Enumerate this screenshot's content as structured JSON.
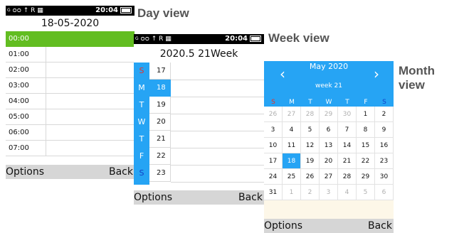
{
  "labels": {
    "day": "Day view",
    "week": "Week view",
    "month": "Month view"
  },
  "statusbar": {
    "signal": "G",
    "icons": "ᴑᴑ ↑ R ▦",
    "time": "20:04"
  },
  "softkeys": {
    "left": "Options",
    "right": "Back"
  },
  "day": {
    "title": "18-05-2020",
    "hours": [
      "00:00",
      "01:00",
      "02:00",
      "03:00",
      "04:00",
      "05:00",
      "06:00",
      "07:00"
    ],
    "selected_index": 0
  },
  "week": {
    "title": "2020.5 21Week",
    "days": [
      {
        "letter": "S",
        "date": "17",
        "color": "red"
      },
      {
        "letter": "M",
        "date": "18",
        "selected": true
      },
      {
        "letter": "T",
        "date": "19"
      },
      {
        "letter": "W",
        "date": "20"
      },
      {
        "letter": "T",
        "date": "21"
      },
      {
        "letter": "F",
        "date": "22"
      },
      {
        "letter": "S",
        "date": "23",
        "color": "blue"
      }
    ]
  },
  "month": {
    "title": "May 2020",
    "subtitle": "week 21",
    "prev_icon": "chevron-left",
    "next_icon": "chevron-right",
    "weekdays": [
      "S",
      "M",
      "T",
      "W",
      "T",
      "F",
      "S"
    ],
    "cells": [
      {
        "d": "26",
        "m": true
      },
      {
        "d": "27",
        "m": true
      },
      {
        "d": "28",
        "m": true
      },
      {
        "d": "29",
        "m": true
      },
      {
        "d": "30",
        "m": true
      },
      {
        "d": "1"
      },
      {
        "d": "2"
      },
      {
        "d": "3"
      },
      {
        "d": "4"
      },
      {
        "d": "5"
      },
      {
        "d": "6"
      },
      {
        "d": "7"
      },
      {
        "d": "8"
      },
      {
        "d": "9"
      },
      {
        "d": "10"
      },
      {
        "d": "11"
      },
      {
        "d": "12"
      },
      {
        "d": "13"
      },
      {
        "d": "14"
      },
      {
        "d": "15"
      },
      {
        "d": "16"
      },
      {
        "d": "17"
      },
      {
        "d": "18",
        "s": true
      },
      {
        "d": "19"
      },
      {
        "d": "20"
      },
      {
        "d": "21"
      },
      {
        "d": "22"
      },
      {
        "d": "23"
      },
      {
        "d": "24"
      },
      {
        "d": "25"
      },
      {
        "d": "26"
      },
      {
        "d": "27"
      },
      {
        "d": "28"
      },
      {
        "d": "29"
      },
      {
        "d": "30"
      },
      {
        "d": "31"
      },
      {
        "d": "1",
        "m": true
      },
      {
        "d": "2",
        "m": true
      },
      {
        "d": "3",
        "m": true
      },
      {
        "d": "4",
        "m": true
      },
      {
        "d": "5",
        "m": true
      },
      {
        "d": "6",
        "m": true
      }
    ]
  },
  "colors": {
    "accent_blue": "#26a4f4",
    "accent_green": "#62bd21",
    "softkey_bg": "#d6d6d6"
  }
}
